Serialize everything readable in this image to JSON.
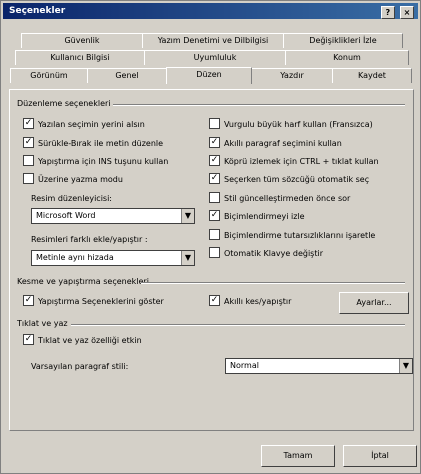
{
  "window": {
    "title": "Seçenekler",
    "help_glyph": "?",
    "close_glyph": "×"
  },
  "tabs": {
    "row1": [
      "Güvenlik",
      "Yazım Denetimi ve Dilbilgisi",
      "Değişiklikleri İzle"
    ],
    "row2": [
      "Kullanıcı Bilgisi",
      "Uyumluluk",
      "Konum"
    ],
    "row3": [
      "Görünüm",
      "Genel",
      "Düzen",
      "Yazdır",
      "Kaydet"
    ],
    "active": "Düzen"
  },
  "editing": {
    "section_label": "Düzenleme seçenekleri",
    "left_options": [
      {
        "label": "Yazılan seçimin yerini alsın",
        "checked": true
      },
      {
        "label": "Sürükle-Bırak ile metin düzenle",
        "checked": true
      },
      {
        "label": "Yapıştırma için INS tuşunu kullan",
        "checked": false
      },
      {
        "label": "Üzerine yazma modu",
        "checked": false
      }
    ],
    "right_options": [
      {
        "label": "Vurgulu büyük harf kullan (Fransızca)",
        "checked": false
      },
      {
        "label": "Akıllı paragraf seçimini kullan",
        "checked": true
      },
      {
        "label": "Köprü izlemek için CTRL + tıklat kullan",
        "checked": true
      },
      {
        "label": "Seçerken tüm sözcüğü otomatik seç",
        "checked": true
      },
      {
        "label": "Stil güncelleştirmeden önce sor",
        "checked": false
      },
      {
        "label": "Biçimlendirmeyi izle",
        "checked": true
      },
      {
        "label": "Biçimlendirme tutarsızlıklarını işaretle",
        "checked": false
      },
      {
        "label": "Otomatik Klavye değiştir",
        "checked": false
      }
    ],
    "picture_editor_label": "Resim düzenleyicisi:",
    "picture_editor_value": "Microsoft Word",
    "insert_paste_label": "Resimleri farklı ekle/yapıştır :",
    "insert_paste_value": "Metinle aynı hizada"
  },
  "cutpaste": {
    "section_label": "Kesme ve yapıştırma seçenekleri",
    "show_paste_option": {
      "label": "Yapıştırma Seçeneklerini göster",
      "checked": true
    },
    "smart_cutpaste": {
      "label": "Akıllı kes/yapıştır",
      "checked": true
    },
    "settings_button": "Ayarlar..."
  },
  "click_type": {
    "section_label": "Tıklat ve yaz",
    "enable_option": {
      "label": "Tıklat ve yaz özelliği etkin",
      "checked": true
    },
    "default_style_label": "Varsayılan paragraf stili:",
    "default_style_value": "Normal"
  },
  "footer": {
    "ok_button": "Tamam",
    "cancel_button": "İptal"
  }
}
